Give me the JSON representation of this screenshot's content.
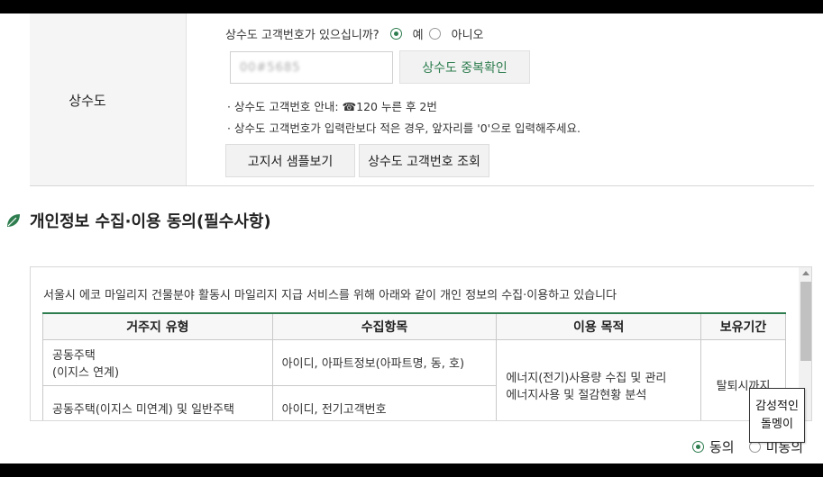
{
  "water": {
    "row_label": "상수도",
    "question": "상수도 고객번호가 있으십니까?",
    "option_yes": "예",
    "option_no": "아니오",
    "selected": "예",
    "customer_number_value": "00#5685",
    "dup_check_button": "상수도 중복확인",
    "note_1": "· 상수도 고객번호 안내: ☎120 누른 후 2번",
    "note_2": "· 상수도 고객번호가 입력란보다 적은 경우, 앞자리를 '0'으로 입력해주세요.",
    "sample_bill_button": "고지서 샘플보기",
    "lookup_button": "상수도 고객번호 조회"
  },
  "privacy": {
    "section_title": "개인정보 수집·이용 동의(필수사항)",
    "intro": "서울시 에코 마일리지 건물분야 활동시 마일리지 지급 서비스를 위해 아래와 같이 개인 정보의 수집·이용하고 있습니다",
    "table": {
      "headers": [
        "거주지 유형",
        "수집항목",
        "이용 목적",
        "보유기간"
      ],
      "rows": [
        {
          "type_line1": "공동주택",
          "type_line2": "(이지스 연계)",
          "items": "아이디, 아파트정보(아파트명, 동, 호)"
        },
        {
          "type_line1": "공동주택(이지스 미연계) 및 일반주택",
          "items": "아이디, 전기고객번호"
        }
      ],
      "purpose_line1": "에너지(전기)사용량 수집 및 관리",
      "purpose_line2": "에너지사용 및 절감현황 분석",
      "retention": "탈퇴시까지"
    },
    "agree_label": "동의",
    "disagree_label": "미동의",
    "agree_selected": "동의"
  },
  "badge": {
    "line1": "감성적인",
    "line2": "돌멩이"
  },
  "colors": {
    "accent": "#2e7d4f",
    "header_bg": "#f5f5f5"
  }
}
